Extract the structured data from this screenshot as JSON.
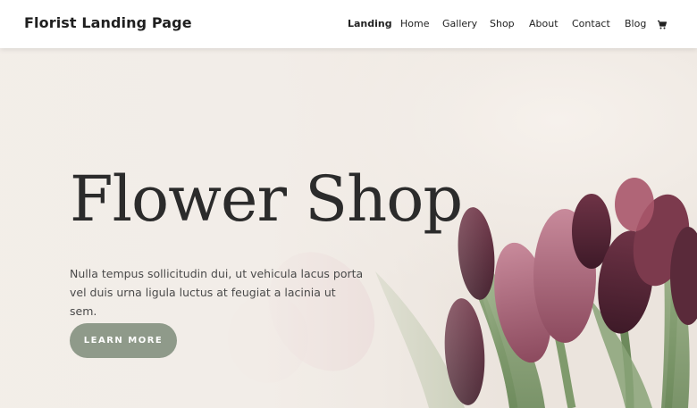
{
  "header": {
    "site_title": "Florist Landing Page",
    "nav": [
      {
        "label": "Landing",
        "active": true
      },
      {
        "label": "Home",
        "active": false
      },
      {
        "label": "Gallery",
        "active": false
      },
      {
        "label": "Shop",
        "active": false
      },
      {
        "label": "About",
        "active": false
      },
      {
        "label": "Contact",
        "active": false
      },
      {
        "label": "Blog",
        "active": false
      }
    ],
    "cart_icon": "cart-icon"
  },
  "hero": {
    "title": "Flower Shop",
    "body": "Nulla tempus sollicitudin dui, ut vehicula lacus porta vel duis urna ligula luctus at feugiat a lacinia ut sem.",
    "cta_label": "LEARN MORE",
    "cta_color": "#8f9a8a"
  },
  "colors": {
    "background": "#f3eee9",
    "title": "#2b2b2b",
    "tulip_dark": "#5a2a3a",
    "tulip_pink": "#b97a8c",
    "stem_green": "#8aa378"
  }
}
